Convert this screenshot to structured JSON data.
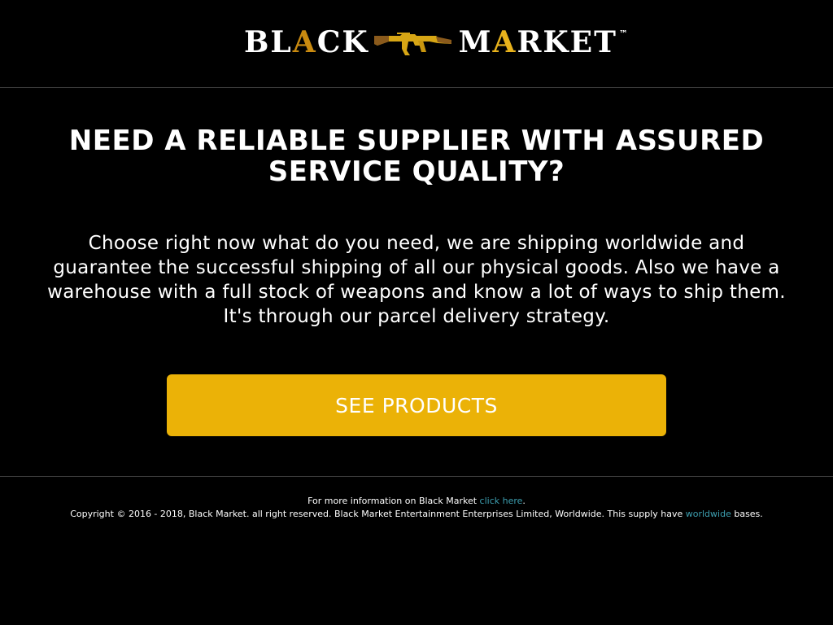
{
  "header": {
    "logo": {
      "word1_a": "BL",
      "word1_b": "A",
      "word1_c": "CK",
      "word2_a": "M",
      "word2_b": "A",
      "word2_c": "RKET",
      "tm": "™",
      "icon": "rifle-icon"
    }
  },
  "hero": {
    "headline_line1": "NEED A RELIABLE SUPPLIER WITH ASSURED",
    "headline_line2": "SERVICE QUALITY?",
    "lead_line1": "Choose right now what do you need, we are shipping worldwide and",
    "lead_line2": "guarantee the successful shipping of all our physical goods. Also we have a",
    "lead_line3": "warehouse with a full stock of weapons and know a lot of ways to ship them.",
    "lead_line4": "It's through our parcel delivery strategy.",
    "cta_label": "SEE PRODUCTS"
  },
  "footer": {
    "info_prefix": "For more information on Black Market ",
    "info_link": "click here",
    "info_suffix": ".",
    "copyright_prefix": "Copyright © 2016 - 2018, Black Market. all right reserved. Black Market Entertainment Enterprises Limited, Worldwide. This supply have ",
    "copyright_link": "worldwide",
    "copyright_suffix": " bases."
  },
  "colors": {
    "background": "#000000",
    "cta": "#ebb207",
    "link": "#3d9fb0",
    "logo_accent": "#e8b21c"
  }
}
